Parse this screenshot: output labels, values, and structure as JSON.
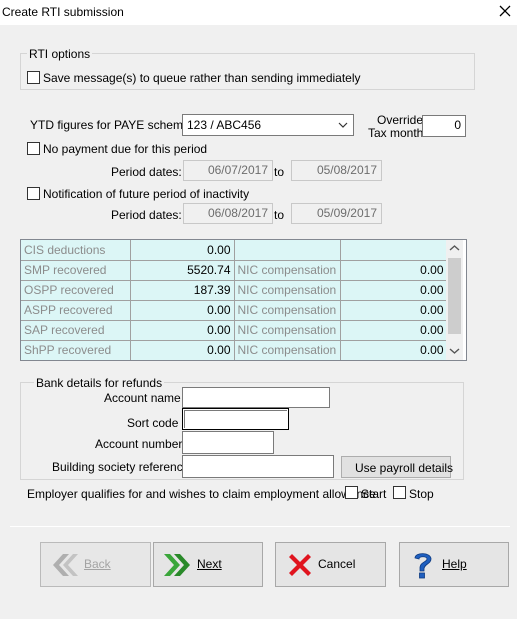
{
  "window": {
    "title": "Create RTI submission"
  },
  "rti_options": {
    "group_label": "RTI options",
    "queue_checkbox_label": "Save message(s) to queue rather than sending immediately"
  },
  "ytd": {
    "label": "YTD figures for PAYE scheme",
    "scheme_selected": "123 / ABC456",
    "override_label_line1": "Override",
    "override_label_line2": "Tax month",
    "override_value": "0"
  },
  "no_payment": {
    "checkbox_label": "No payment due for this period",
    "period_label": "Period dates:",
    "from": "06/07/2017",
    "to_label": "to",
    "to": "05/08/2017"
  },
  "inactivity": {
    "checkbox_label": "Notification of future period of inactivity",
    "period_label": "Period dates:",
    "from": "06/08/2017",
    "to_label": "to",
    "to": "05/09/2017"
  },
  "grid_rows": [
    {
      "label": "CIS deductions",
      "value": "0.00",
      "label2": "",
      "value2": ""
    },
    {
      "label": "SMP recovered",
      "value": "5520.74",
      "label2": "NIC compensation",
      "value2": "0.00"
    },
    {
      "label": "OSPP recovered",
      "value": "187.39",
      "label2": "NIC compensation",
      "value2": "0.00"
    },
    {
      "label": "ASPP recovered",
      "value": "0.00",
      "label2": "NIC compensation",
      "value2": "0.00"
    },
    {
      "label": "SAP recovered",
      "value": "0.00",
      "label2": "NIC compensation",
      "value2": "0.00"
    },
    {
      "label": "ShPP recovered",
      "value": "0.00",
      "label2": "NIC compensation",
      "value2": "0.00"
    }
  ],
  "bank": {
    "group_label": "Bank details for refunds",
    "account_name_label": "Account name",
    "account_name_value": "",
    "sort_code_label": "Sort code",
    "sort_code_value": "",
    "account_number_label": "Account number",
    "account_number_value": "",
    "building_society_label": "Building society reference",
    "building_society_value": "",
    "use_payroll_button": "Use payroll details"
  },
  "employment_allowance": {
    "label": "Employer qualifies for and wishes to claim employment allowance",
    "start_label": "Start",
    "stop_label": "Stop"
  },
  "buttons": {
    "back": "Back",
    "next": "Next",
    "cancel": "Cancel",
    "help": "Help"
  },
  "colors": {
    "grid_cell": "#dcf6f6",
    "next_arrow": "#2fa52f",
    "cancel_x": "#e0141e",
    "help_icon": "#1f5fbf"
  }
}
